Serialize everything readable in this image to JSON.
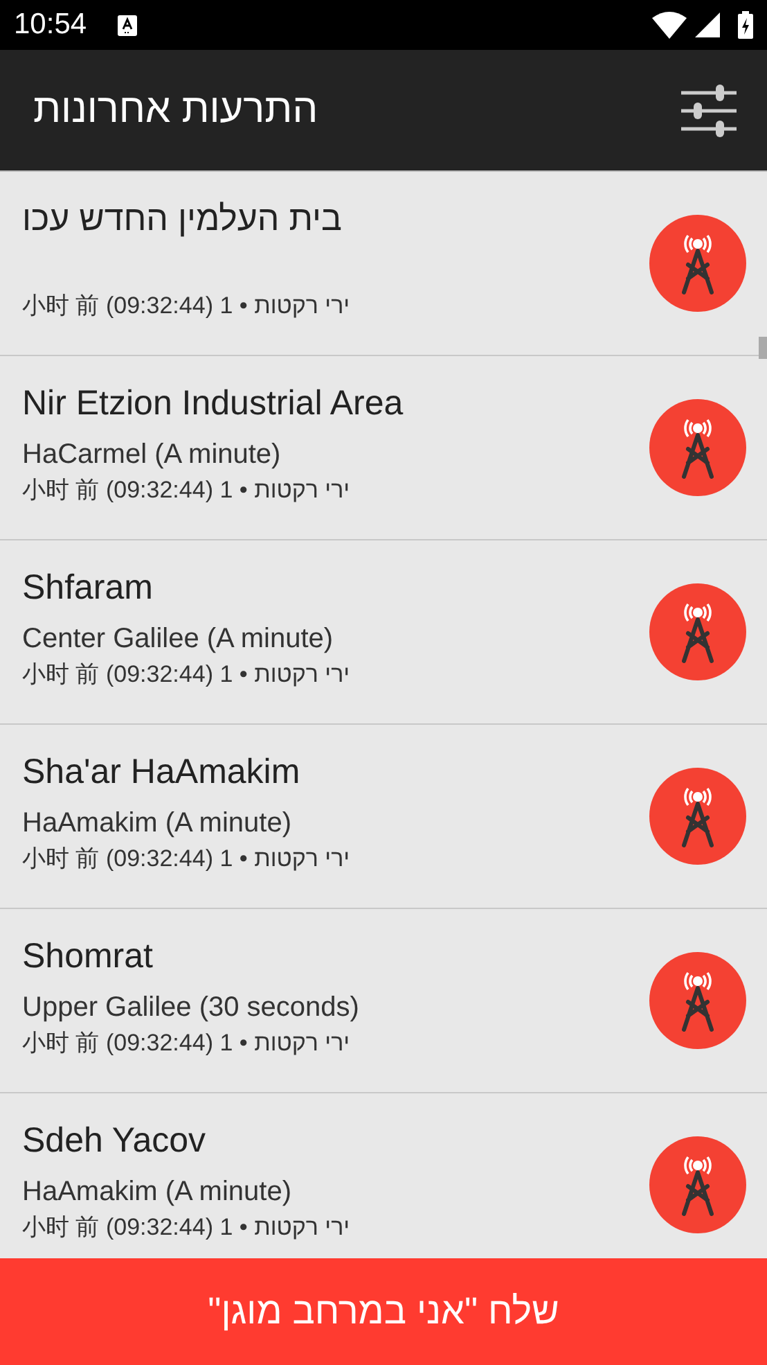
{
  "status_bar": {
    "time": "10:54"
  },
  "app_bar": {
    "title": "התרעות אחרונות"
  },
  "alerts": [
    {
      "title": "בית העלמין החדש עכו",
      "meta": "ירי רקטות • 1 (09:32:44) 小时 前"
    },
    {
      "title": "Nir Etzion Industrial Area",
      "subtitle": "HaCarmel (A minute)",
      "meta": "ירי רקטות • 1 (09:32:44) 小时 前"
    },
    {
      "title": "Shfaram",
      "subtitle": "Center Galilee (A minute)",
      "meta": "ירי רקטות • 1 (09:32:44) 小时 前"
    },
    {
      "title": "Sha'ar HaAmakim",
      "subtitle": "HaAmakim (A minute)",
      "meta": "ירי רקטות • 1 (09:32:44) 小时 前"
    },
    {
      "title": "Shomrat",
      "subtitle": "Upper Galilee (30 seconds)",
      "meta": "ירי רקטות • 1 (09:32:44) 小时 前"
    },
    {
      "title": "Sdeh Yacov",
      "subtitle": "HaAmakim (A minute)",
      "meta": "ירי רקטות • 1 (09:32:44) 小时 前"
    }
  ],
  "action_button": {
    "label": "שלח \"אני במרחב מוגן\""
  }
}
